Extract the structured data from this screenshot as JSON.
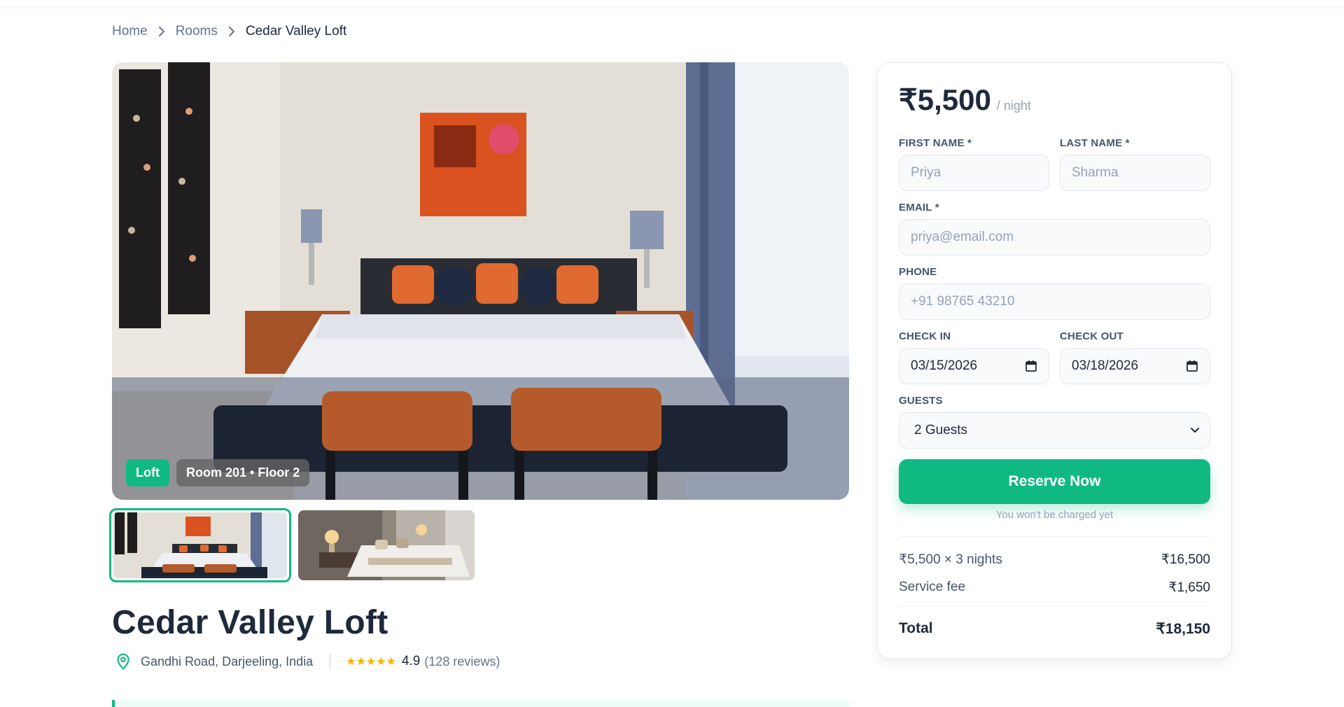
{
  "breadcrumb": {
    "items": [
      "Home",
      "Rooms"
    ],
    "current": "Cedar Valley Loft"
  },
  "room": {
    "name": "Cedar Valley Loft",
    "type_badge": "Loft",
    "location_badge": "Room 201 • Floor 2",
    "address": "Gandhi Road, Darjeeling, India",
    "stars": "★★★★★",
    "rating": "4.9",
    "reviews": "(128 reviews)"
  },
  "gallery": {
    "thumbnails": [
      "bedroom-photo-1",
      "bedroom-photo-2"
    ],
    "active_index": 0
  },
  "booking": {
    "price": "₹5,500",
    "per_night": "/ night",
    "first_name_label": "FIRST NAME *",
    "first_name_placeholder": "Priya",
    "last_name_label": "LAST NAME *",
    "last_name_placeholder": "Sharma",
    "email_label": "EMAIL *",
    "email_placeholder": "priya@email.com",
    "phone_label": "PHONE",
    "phone_placeholder": "+91 98765 43210",
    "checkin_label": "CHECK IN",
    "checkin_value": "03/15/2026",
    "checkout_label": "CHECK OUT",
    "checkout_value": "03/18/2026",
    "guests_label": "GUESTS",
    "guests_value": "2 Guests",
    "reserve_button": "Reserve Now",
    "note": "You won't be charged yet",
    "nights_label": "₹5,500 × 3 nights",
    "nights_value": "₹16,500",
    "service_fee_label": "Service fee",
    "service_fee_value": "₹1,650",
    "total_label": "Total",
    "total_value": "₹18,150"
  },
  "colors": {
    "accent": "#10b981",
    "text_dark": "#1e293b",
    "text_muted": "#64748b",
    "star": "#f5b400"
  }
}
